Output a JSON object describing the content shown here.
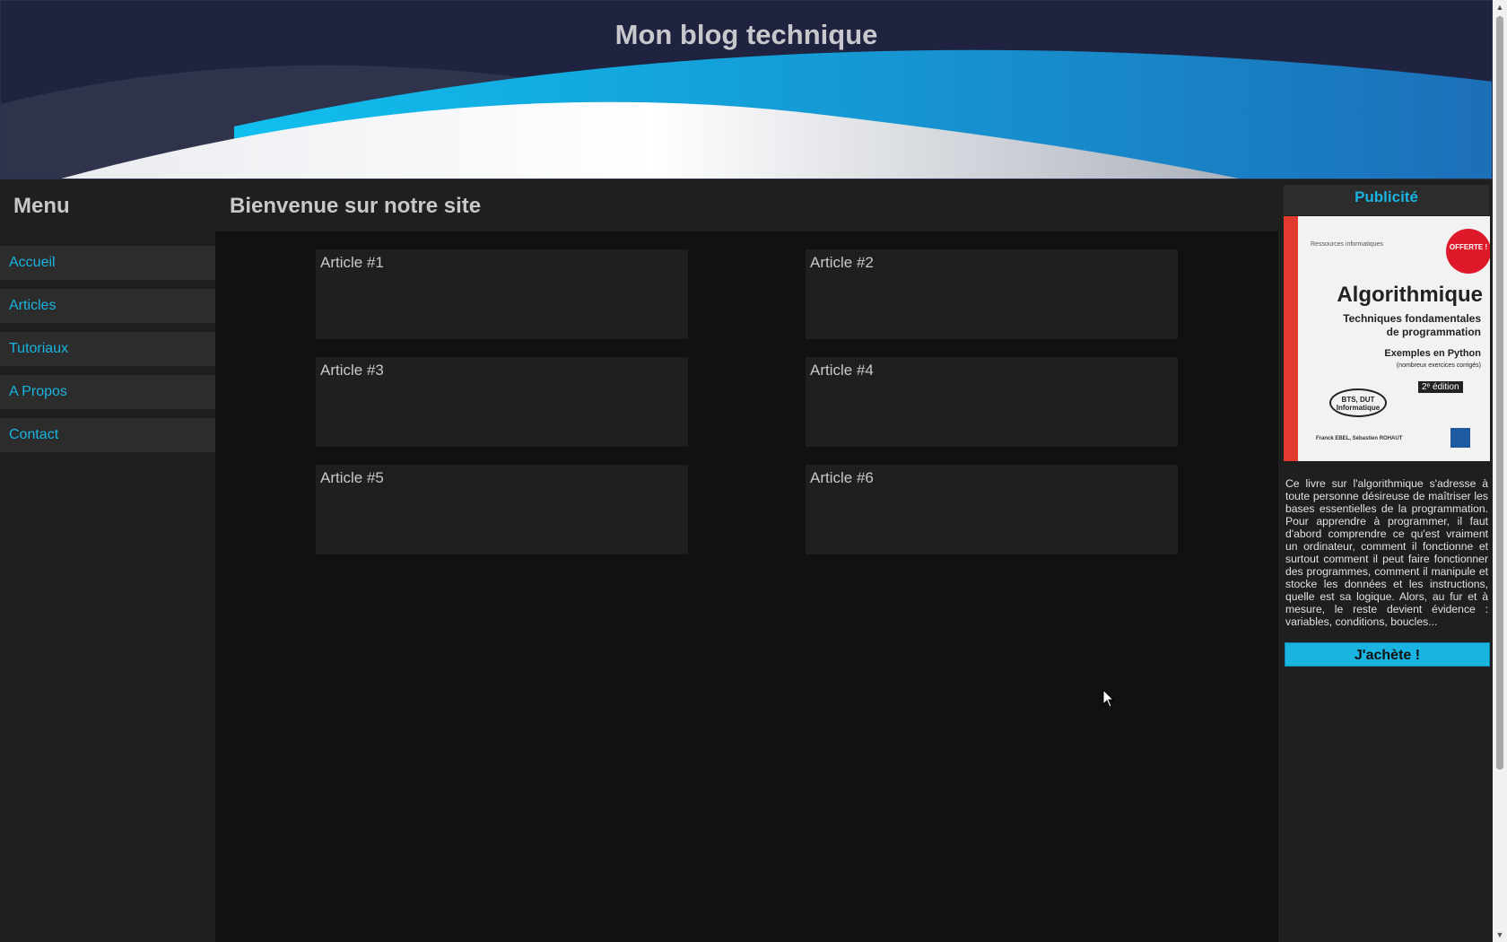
{
  "header": {
    "title": "Mon blog technique"
  },
  "sidebar": {
    "title": "Menu",
    "items": [
      {
        "label": "Accueil"
      },
      {
        "label": "Articles"
      },
      {
        "label": "Tutoriaux"
      },
      {
        "label": "A Propos"
      },
      {
        "label": "Contact"
      }
    ]
  },
  "main": {
    "title": "Bienvenue sur notre site",
    "articles": [
      {
        "title": "Article #1"
      },
      {
        "title": "Article #2"
      },
      {
        "title": "Article #3"
      },
      {
        "title": "Article #4"
      },
      {
        "title": "Article #5"
      },
      {
        "title": "Article #6"
      }
    ]
  },
  "aside": {
    "title": "Publicité",
    "book": {
      "brand": "Ressources informatiques",
      "badge": "OFFERTE !",
      "title": "Algorithmique",
      "subtitle_1": "Techniques fondamentales",
      "subtitle_2": "de programmation",
      "examples": "Exemples en Python",
      "examples_note": "(nombreux exercices corrigés)",
      "edition": "2ᵉ édition",
      "bts": "BTS, DUT Informatique",
      "authors": "Franck EBEL, Sébastien ROHAUT"
    },
    "description": "Ce livre sur l'algorithmique s'adresse à toute personne désireuse de maîtriser les bases essentielles de la programmation. Pour apprendre à programmer, il faut d'abord comprendre ce qu'est vraiment un ordinateur, comment il fonctionne et surtout comment il peut faire fonctionner des programmes, comment il manipule et stocke les données et les instructions, quelle est sa logique. Alors, au fur et à mesure, le reste devient évidence : variables, conditions, boucles...",
    "buy_label": "J'achète !"
  },
  "colors": {
    "accent": "#19b4e0",
    "panel": "#1f1f1f",
    "background": "#111111",
    "header": "#1f2340"
  }
}
